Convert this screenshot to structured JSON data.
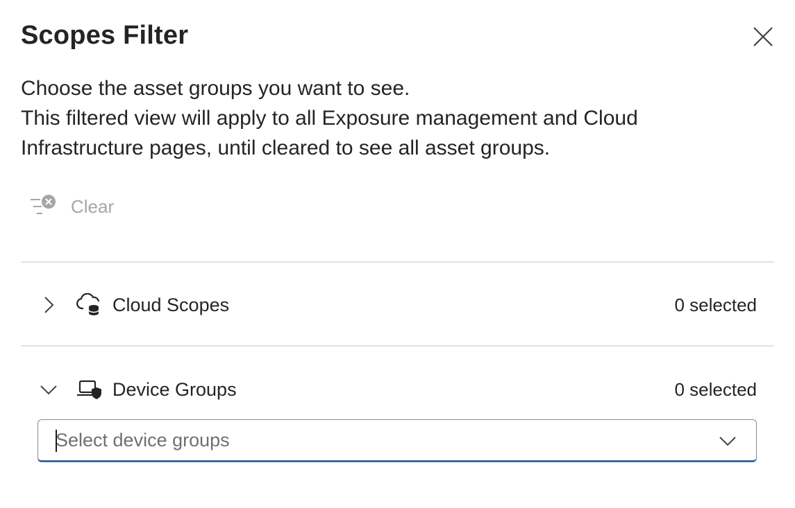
{
  "panel": {
    "title": "Scopes Filter",
    "close_icon": "close-icon"
  },
  "description": {
    "line1": "Choose the asset groups you want to see.",
    "line2": "This filtered view will apply to all Exposure management and Cloud Infrastructure pages, until cleared to see all asset groups."
  },
  "toolbar": {
    "clear_label": "Clear",
    "clear_icon": "filter-dismiss-icon",
    "clear_enabled": false
  },
  "sections": [
    {
      "label": "Cloud Scopes",
      "count_text": "0 selected",
      "expanded": false,
      "icon": "cloud-database-icon"
    },
    {
      "label": "Device Groups",
      "count_text": "0 selected",
      "expanded": true,
      "icon": "laptop-shield-icon"
    }
  ],
  "device_groups_select": {
    "placeholder": "Select device groups",
    "value": ""
  },
  "colors": {
    "text": "#242424",
    "disabled_text": "#a6a6a6",
    "divider": "#e1e1e1",
    "focus_underline": "#3a6b98"
  }
}
